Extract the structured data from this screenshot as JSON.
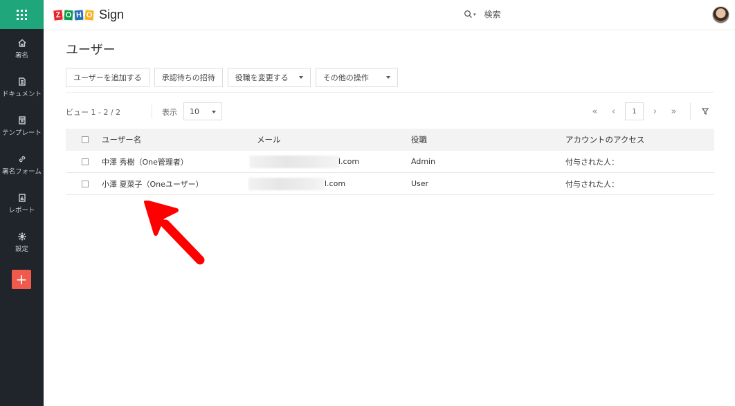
{
  "app": {
    "brand_letters": [
      "Z",
      "O",
      "H",
      "O"
    ],
    "brand_colors": [
      "#e42527",
      "#089949",
      "#226db4",
      "#f9b21d"
    ],
    "product": "Sign"
  },
  "sidebar": {
    "items": [
      {
        "label": "署名",
        "icon": "home-icon"
      },
      {
        "label": "ドキュメント",
        "icon": "document-icon"
      },
      {
        "label": "テンプレート",
        "icon": "template-icon"
      },
      {
        "label": "署名フォーム",
        "icon": "link-icon"
      },
      {
        "label": "レポート",
        "icon": "report-icon"
      },
      {
        "label": "設定",
        "icon": "gear-icon"
      }
    ],
    "add_label": "+"
  },
  "header": {
    "search_label": "検索"
  },
  "page": {
    "title": "ユーザー"
  },
  "toolbar": {
    "add_user": "ユーザーを追加する",
    "pending_invites": "承認待ちの招待",
    "change_role": "役職を変更する",
    "other_actions": "その他の操作"
  },
  "view": {
    "count_text": "ビュー 1 - 2 / 2",
    "show_label": "表示",
    "page_size": "10",
    "current_page": "1",
    "first": "«",
    "prev": "‹",
    "next": "›",
    "last": "»"
  },
  "table": {
    "headers": [
      "ユーザー名",
      "メール",
      "役職",
      "アカウントのアクセス"
    ],
    "rows": [
      {
        "name": "中澤 秀樹（One管理者）",
        "email_visible": "l.com",
        "role": "Admin",
        "access": "付与された人："
      },
      {
        "name": "小澤 夏菜子（Oneユーザー）",
        "email_visible": "l.com",
        "role": "User",
        "access": "付与された人："
      }
    ]
  },
  "colors": {
    "sidebar_bg": "#20252b",
    "apps_bg": "#1fa67a",
    "add_button": "#ef5a4c",
    "annotation": "#ff0000"
  }
}
